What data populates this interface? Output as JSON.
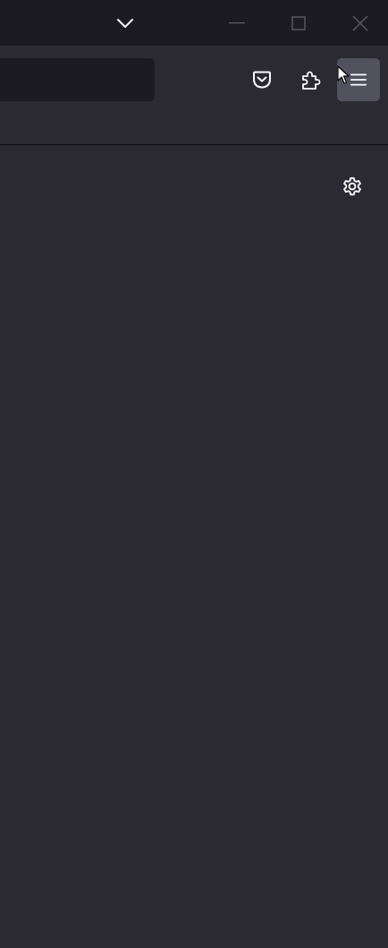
{
  "titlebar": {
    "tab_list_icon": "chevron-down-icon",
    "minimize_icon": "minimize-icon",
    "maximize_icon": "maximize-icon",
    "close_icon": "close-icon"
  },
  "toolbar": {
    "urlbar_value": "",
    "pocket_icon": "pocket-icon",
    "extensions_icon": "puzzle-icon",
    "menu_icon": "hamburger-menu-icon"
  },
  "content": {
    "settings_icon": "gear-icon"
  },
  "colors": {
    "titlebar_bg": "#1c1b22",
    "toolbar_bg": "#2b2a33",
    "urlbar_bg": "#1c1b22",
    "menu_active_bg": "#52525e",
    "icon_color": "#fbfbfe"
  }
}
